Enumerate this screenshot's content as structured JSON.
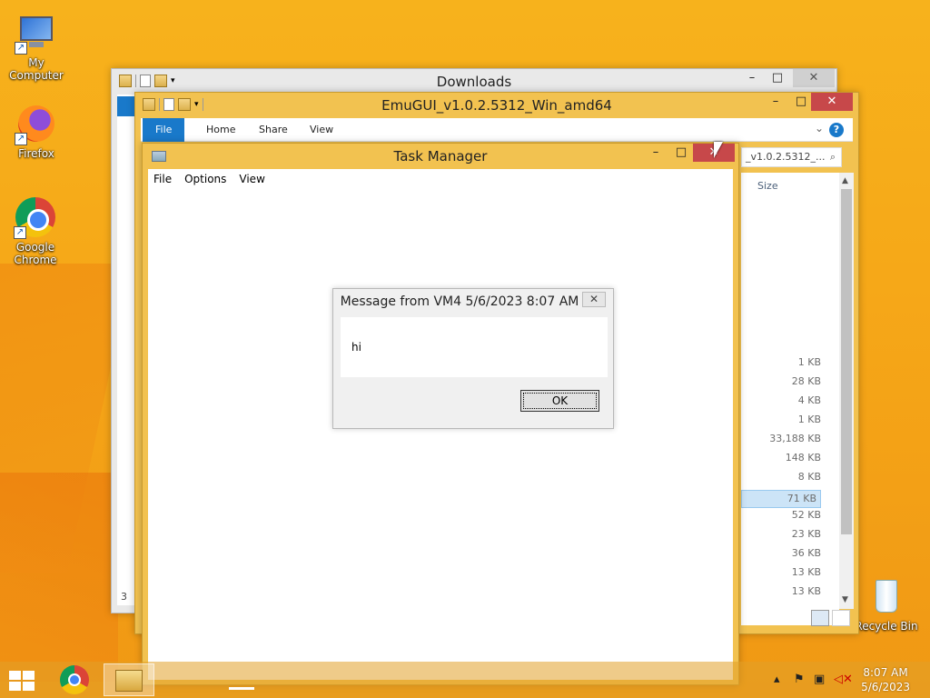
{
  "desktop": {
    "icons": [
      {
        "label": "My Computer"
      },
      {
        "label": "Firefox"
      },
      {
        "label": "Google Chrome"
      },
      {
        "label": "Recycle Bin"
      }
    ]
  },
  "downloads_window": {
    "title": "Downloads",
    "status_text": "3"
  },
  "emugui_window": {
    "title": "EmuGUI_v1.0.2.5312_Win_amd64",
    "ribbon_tabs": [
      "File",
      "Home",
      "Share",
      "View"
    ],
    "address_text": "_v1.0.2.5312_...",
    "column_header": "Size",
    "sizes": [
      "1 KB",
      "28 KB",
      "4 KB",
      "1 KB",
      "33,188 KB",
      "148 KB",
      "8 KB",
      "71 KB",
      "52 KB",
      "23 KB",
      "36 KB",
      "13 KB",
      "13 KB"
    ],
    "selected_index": 7
  },
  "task_manager": {
    "title": "Task Manager",
    "menu": [
      "File",
      "Options",
      "View"
    ]
  },
  "dialog": {
    "title": "Message from VM4 5/6/2023 8:07 AM",
    "message": "hi",
    "ok_label": "OK",
    "close_label": "✕"
  },
  "taskbar": {
    "time": "8:07 AM",
    "date": "5/6/2023"
  },
  "window_controls": {
    "minimize": "–",
    "maximize": "□",
    "close": "✕"
  }
}
